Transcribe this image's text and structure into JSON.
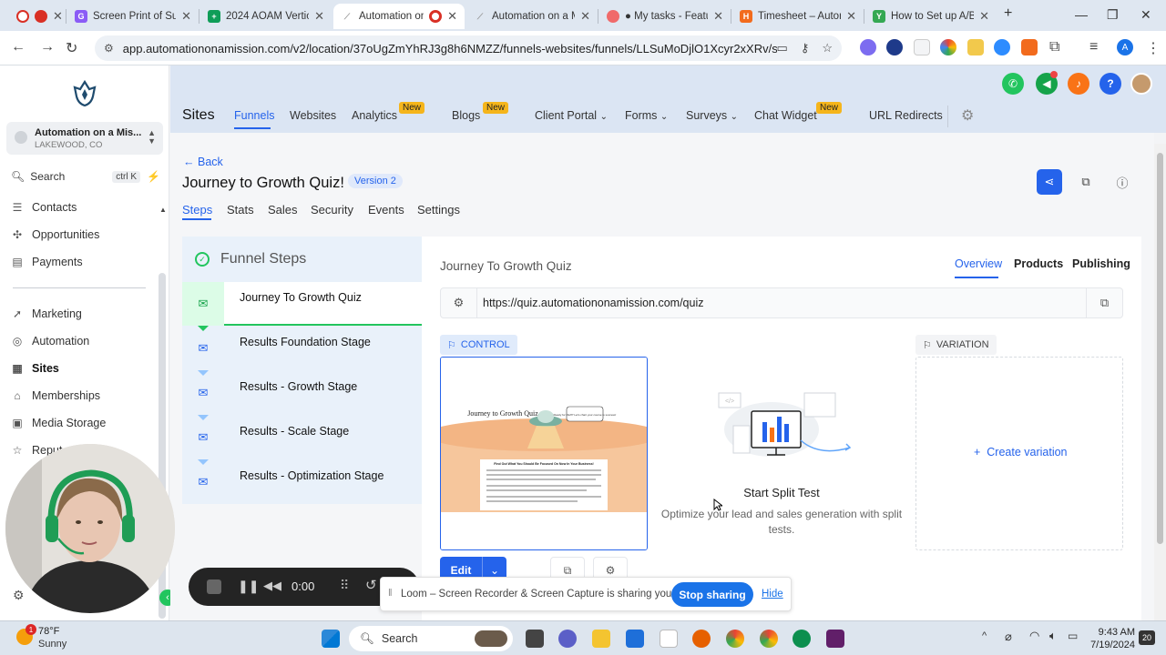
{
  "browser": {
    "tabs": [
      {
        "title": "",
        "fav_color": "#d93025"
      },
      {
        "title": "Screen Print of Sur",
        "fav_color": "#8b5cf6"
      },
      {
        "title": "2024 AOAM Vertica",
        "fav_color": "#0f9d58"
      },
      {
        "title": "Automation on",
        "fav_color": "#ffffff"
      },
      {
        "title": "Automation on a M",
        "fav_color": "#ffffff"
      },
      {
        "title": "● My tasks - Featur",
        "fav_color": "#f06a6a"
      },
      {
        "title": "Timesheet – Autom",
        "fav_color": "#f26b1d"
      },
      {
        "title": "How to Set up A/B",
        "fav_color": "#34a853"
      }
    ],
    "url": "app.automationonamission.com/v2/location/37oUgZmYhRJ3g8h6NMZZ/funnels-websites/funnels/LLSuMoDjlO1Xcyr2xXRv/steps/8b5f7f..."
  },
  "sidebar": {
    "location_name": "Automation on a Mis...",
    "location_city": "LAKEWOOD, CO",
    "search_label": "Search",
    "search_shortcut": "ctrl K",
    "items": [
      {
        "label": "Contacts",
        "icon": "contacts-icon"
      },
      {
        "label": "Opportunities",
        "icon": "opportunities-icon"
      },
      {
        "label": "Payments",
        "icon": "payments-icon"
      },
      {
        "label": "Marketing",
        "icon": "marketing-icon"
      },
      {
        "label": "Automation",
        "icon": "automation-icon"
      },
      {
        "label": "Sites",
        "icon": "sites-icon"
      },
      {
        "label": "Memberships",
        "icon": "memberships-icon"
      },
      {
        "label": "Media Storage",
        "icon": "media-storage-icon"
      },
      {
        "label": "Reput",
        "icon": "reputation-icon"
      }
    ]
  },
  "topnav": {
    "section": "Sites",
    "new_badge": "New",
    "items": [
      "Funnels",
      "Websites",
      "Analytics",
      "Blogs",
      "Client Portal",
      "Forms",
      "Surveys",
      "Chat Widget",
      "URL Redirects"
    ]
  },
  "page": {
    "back_label": "Back",
    "title": "Journey to Growth Quiz!",
    "version": "Version 2",
    "tabs": [
      "Steps",
      "Stats",
      "Sales",
      "Security",
      "Events",
      "Settings"
    ]
  },
  "funnel_steps": {
    "heading": "Funnel Steps",
    "steps": [
      "Journey To Growth Quiz",
      "Results Foundation Stage",
      "Results - Growth Stage",
      "Results - Scale Stage",
      "Results - Optimization Stage"
    ]
  },
  "step_detail": {
    "title": "Journey To Growth Quiz",
    "tabs": [
      "Overview",
      "Products",
      "Publishing"
    ],
    "url": "https://quiz.automationonamission.com/quiz",
    "control_label": "CONTROL",
    "variation_label": "VARIATION",
    "edit_label": "Edit",
    "split_title": "Start Split Test",
    "split_desc": "Optimize your lead and sales generation with split tests.",
    "create_variation": "Create variation",
    "thumb": {
      "title": "Journey to Growth Quiz",
      "bubble": "Ready for liftoff? Let's chart your course to success!",
      "heading": "Find Out What You Should Be Focused On Now In Your Business!"
    }
  },
  "loom": {
    "timer": "0:00",
    "share_text": "Loom – Screen Recorder & Screen Capture is sharing your screen.",
    "stop_label": "Stop sharing",
    "hide_label": "Hide"
  },
  "taskbar": {
    "temp": "78°F",
    "condition": "Sunny",
    "weather_badge": "1",
    "search_label": "Search",
    "time": "9:43 AM",
    "date": "7/19/2024",
    "notif_count": "20"
  }
}
